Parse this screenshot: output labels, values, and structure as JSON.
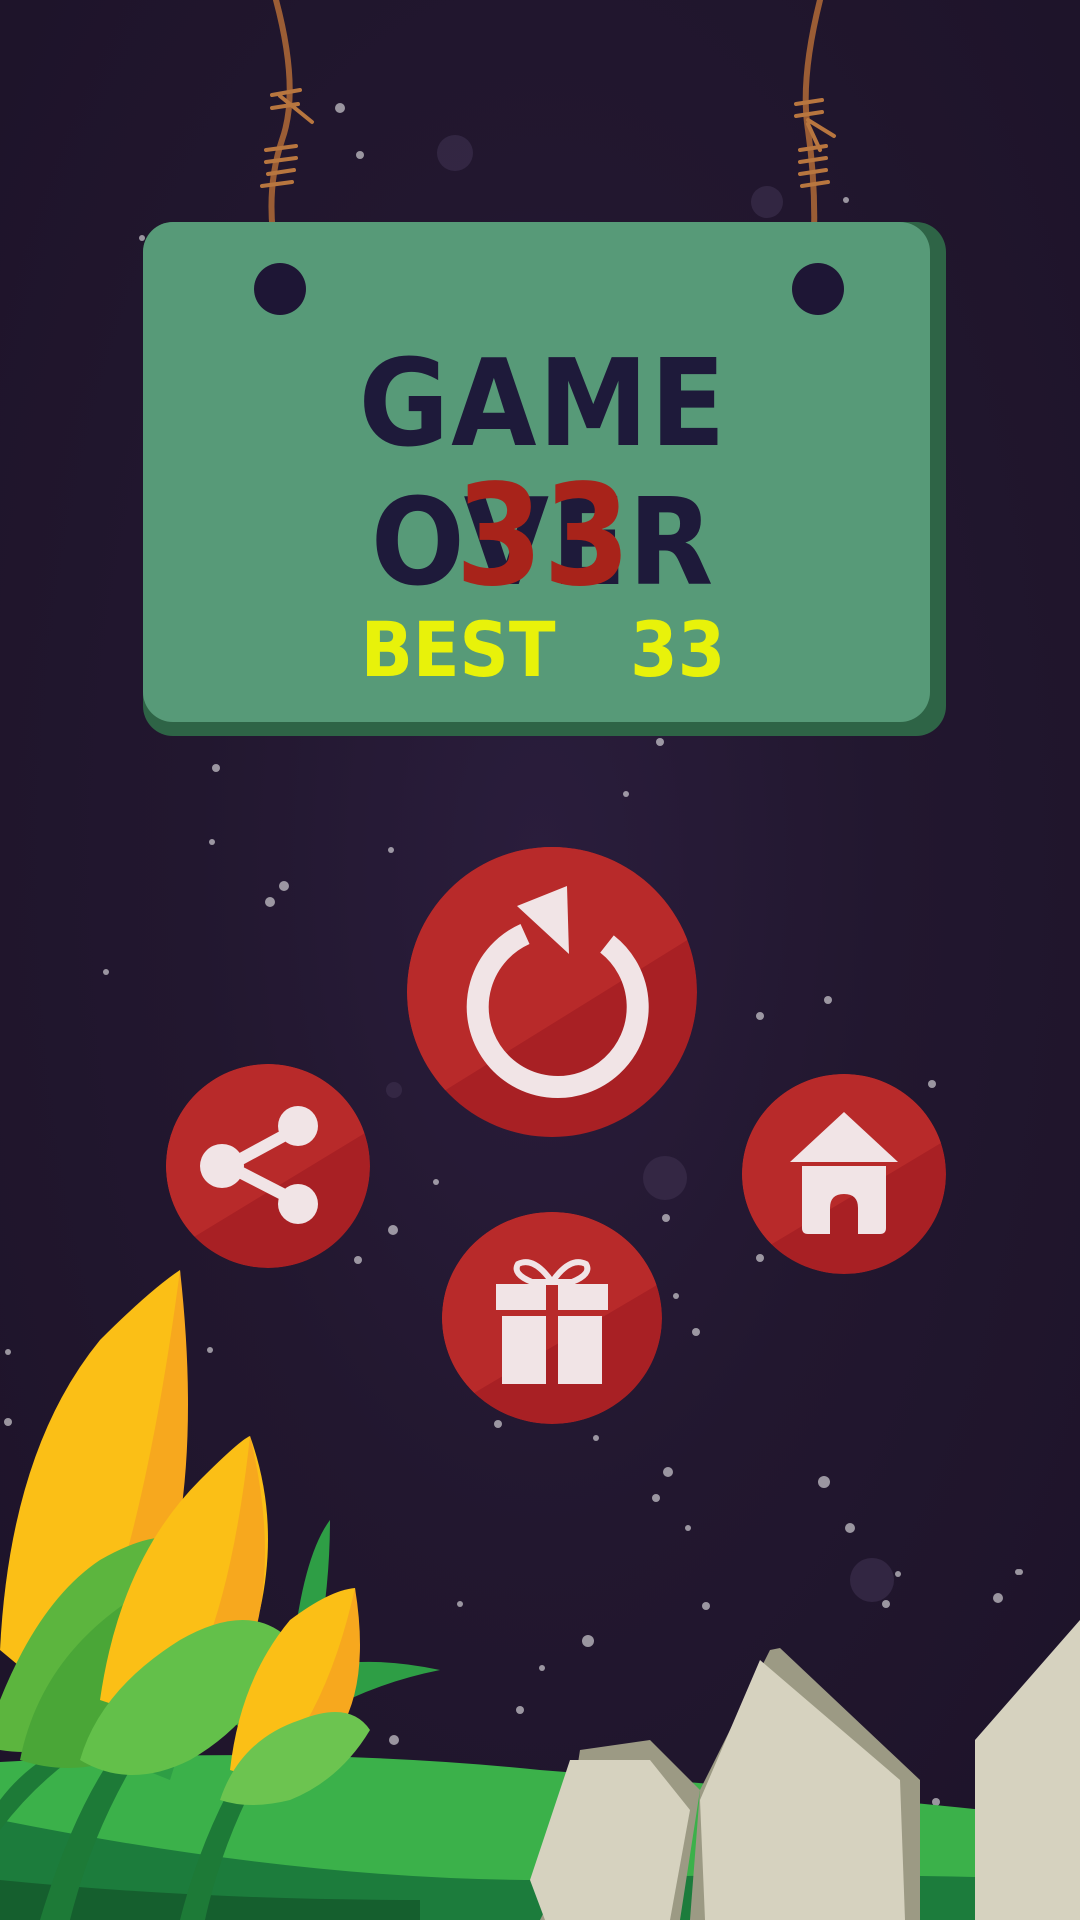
{
  "sign": {
    "title": "GAME OVER",
    "score": "33",
    "best_label": "BEST",
    "best_value": "33"
  },
  "buttons": [
    {
      "name": "replay-button",
      "icon": "replay-icon"
    },
    {
      "name": "share-button",
      "icon": "share-icon"
    },
    {
      "name": "home-button",
      "icon": "home-icon"
    },
    {
      "name": "gift-button",
      "icon": "gift-icon"
    }
  ],
  "colors": {
    "background": "#22172f",
    "sign": "#579a78",
    "sign_shadow": "#2e6446",
    "title": "#1e1a3a",
    "score": "#a8231a",
    "best": "#e8f20a",
    "button": "#b4282a",
    "icon": "#f1e4e6"
  }
}
